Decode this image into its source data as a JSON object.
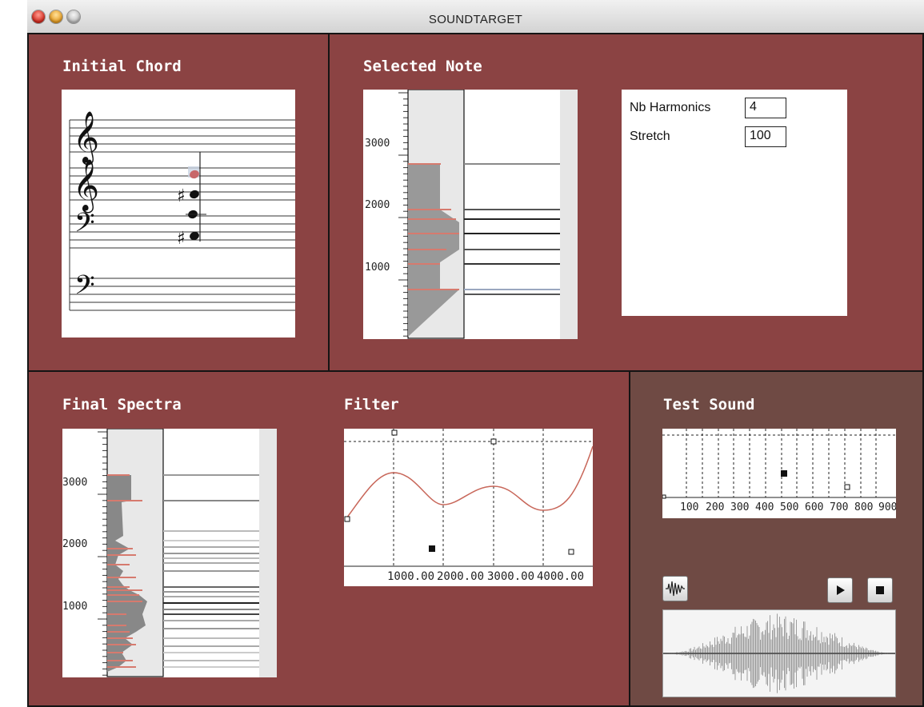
{
  "window": {
    "title": "SOUNDTARGET"
  },
  "panels": {
    "initial_chord": {
      "heading": "Initial Chord"
    },
    "selected_note": {
      "heading": "Selected Note",
      "axis_ticks": [
        "3000",
        "2000",
        "1000"
      ]
    },
    "params": {
      "nb_harmonics_label": "Nb Harmonics",
      "nb_harmonics_value": "4",
      "stretch_label": "Stretch",
      "stretch_value": "100"
    },
    "final_spectra": {
      "heading": "Final Spectra",
      "axis_ticks": [
        "3000",
        "2000",
        "1000"
      ]
    },
    "filter": {
      "heading": "Filter",
      "x_ticks": [
        "1000.00",
        "2000.00",
        "3000.00",
        "4000.00"
      ]
    },
    "test_sound": {
      "heading": "Test Sound",
      "x_ticks": [
        "100",
        "200",
        "300",
        "400",
        "500",
        "600",
        "700",
        "800",
        "900"
      ]
    }
  },
  "icons": {
    "waveform_button": "waveform-icon",
    "play_button": "play-icon",
    "stop_button": "stop-icon"
  },
  "colors": {
    "panel_red": "#8b4343",
    "panel_brown": "#6f4a44",
    "harmonic_red": "#d67a6e",
    "filter_curve": "#c8675a"
  }
}
